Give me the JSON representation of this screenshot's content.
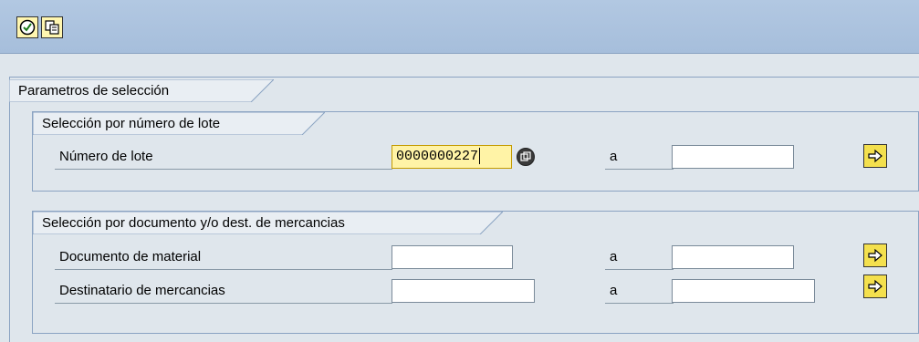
{
  "toolbar": {
    "buttons": [
      {
        "icon": "execute-clock-icon"
      },
      {
        "icon": "copy-variant-icon"
      }
    ]
  },
  "main": {
    "frame_title": "Parametros de selección",
    "group_lote": {
      "title": "Selección por número de lote",
      "row": {
        "label": "Número de lote",
        "from_value": "0000000227",
        "to_label": "a",
        "to_value": ""
      }
    },
    "group_doc": {
      "title": "Selección por documento y/o dest. de mercancias",
      "rows": [
        {
          "label": "Documento de material",
          "from_value": "",
          "to_label": "a",
          "to_value": ""
        },
        {
          "label": "Destinatario de mercancias",
          "from_value": "",
          "to_label": "a",
          "to_value": ""
        }
      ]
    }
  },
  "colors": {
    "toolbar_bg": "#a6bedb",
    "content_bg": "#dfe6ec",
    "active_field": "#fff3a6",
    "arrow_button": "#f4e04d"
  }
}
